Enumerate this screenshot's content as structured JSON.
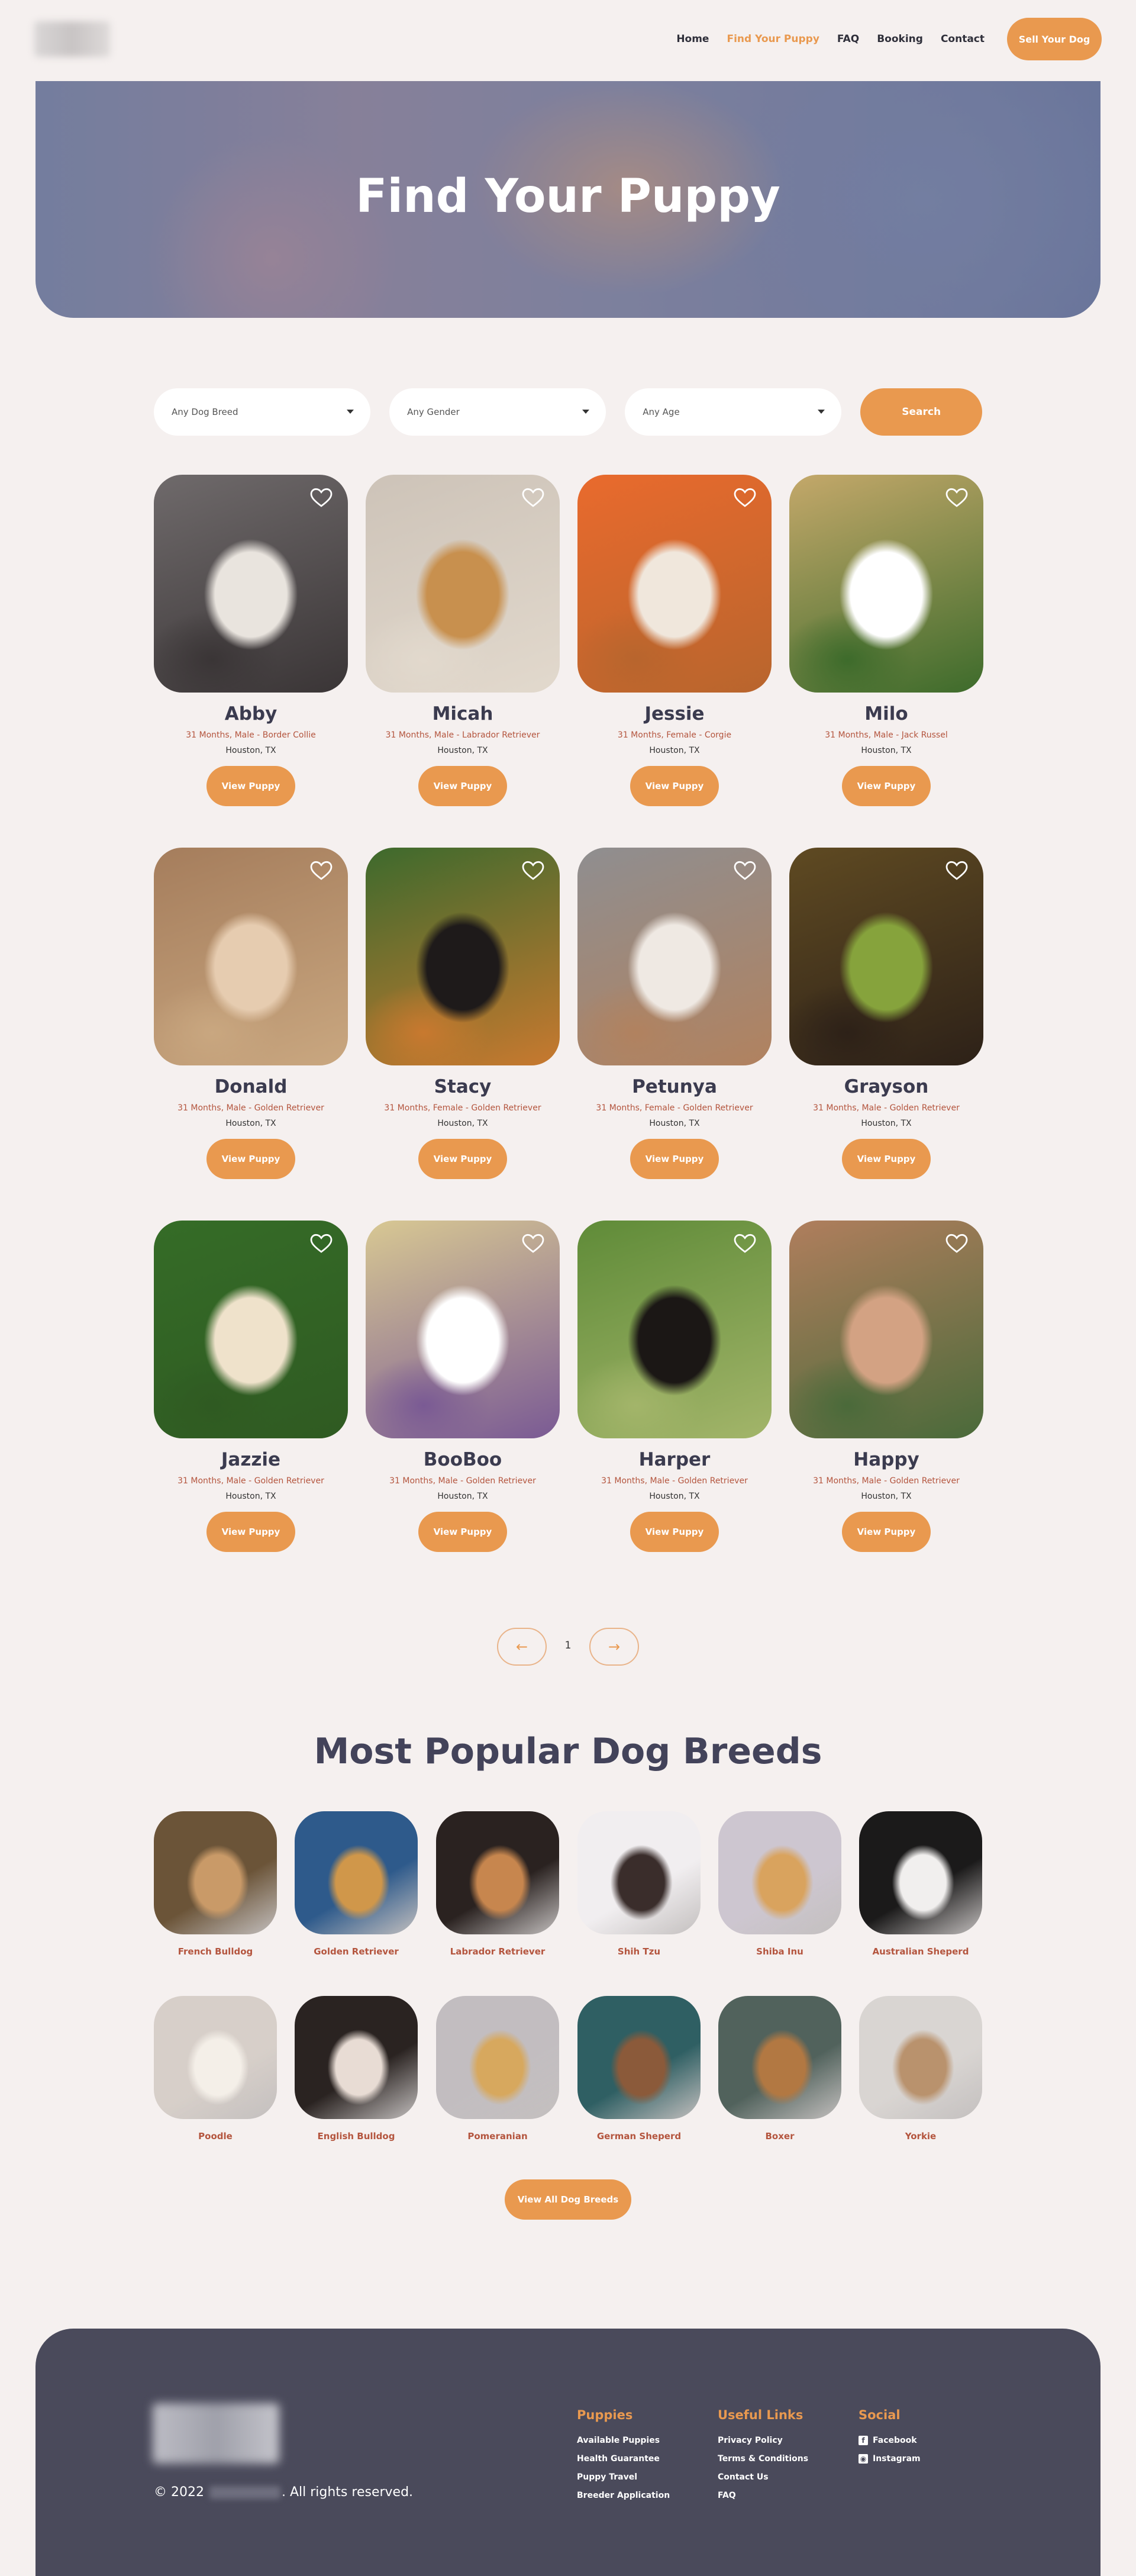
{
  "header": {
    "nav": [
      "Home",
      "Find Your Puppy",
      "FAQ",
      "Booking",
      "Contact"
    ],
    "active_index": 1,
    "sell_button": "Sell Your Dog"
  },
  "hero": {
    "title": "Find Your Puppy"
  },
  "filters": {
    "breed": "Any Dog Breed",
    "gender": "Any Gender",
    "age": "Any Age",
    "search_button": "Search"
  },
  "puppies": [
    {
      "name": "Abby",
      "meta": "31 Months, Male - Border Collie",
      "location": "Houston, TX",
      "button": "View Puppy",
      "colors": [
        "#6f6a6b",
        "#e9e4de",
        "#3a3536"
      ]
    },
    {
      "name": "Micah",
      "meta": "31 Months, Male - Labrador Retriever",
      "location": "Houston, TX",
      "button": "View Puppy",
      "colors": [
        "#cdc3b8",
        "#c8904e",
        "#e2d9cd"
      ]
    },
    {
      "name": "Jessie",
      "meta": "31 Months, Female - Corgie",
      "location": "Houston, TX",
      "button": "View Puppy",
      "colors": [
        "#e96a2d",
        "#f0e7dc",
        "#b8652d"
      ]
    },
    {
      "name": "Milo",
      "meta": "31 Months, Male - Jack Russel",
      "location": "Houston, TX",
      "button": "View Puppy",
      "colors": [
        "#c4a86a",
        "#ffffff",
        "#3d6b2b"
      ]
    },
    {
      "name": "Donald",
      "meta": "31 Months, Male - Golden Retriever",
      "location": "Houston, TX",
      "button": "View Puppy",
      "colors": [
        "#a57d5c",
        "#e6ccb0",
        "#c9a780"
      ]
    },
    {
      "name": "Stacy",
      "meta": "31 Months, Female - Golden Retriever",
      "location": "Houston, TX",
      "button": "View Puppy",
      "colors": [
        "#3d6a2d",
        "#1e1a1a",
        "#c8792f"
      ]
    },
    {
      "name": "Petunya",
      "meta": "31 Months, Female - Golden Retriever",
      "location": "Houston, TX",
      "button": "View Puppy",
      "colors": [
        "#8f8e90",
        "#efe9e3",
        "#b1825f"
      ]
    },
    {
      "name": "Grayson",
      "meta": "31 Months, Male - Golden Retriever",
      "location": "Houston, TX",
      "button": "View Puppy",
      "colors": [
        "#5f4a22",
        "#86a33c",
        "#2d2118"
      ]
    },
    {
      "name": "Jazzie",
      "meta": "31 Months, Male - Golden Retriever",
      "location": "Houston, TX",
      "button": "View Puppy",
      "colors": [
        "#356c27",
        "#efe2cb",
        "#2f5a22"
      ]
    },
    {
      "name": "BooBoo",
      "meta": "31 Months, Male - Golden Retriever",
      "location": "Houston, TX",
      "button": "View Puppy",
      "colors": [
        "#d8c893",
        "#ffffff",
        "#7a5a94"
      ]
    },
    {
      "name": "Harper",
      "meta": "31 Months, Male - Golden Retriever",
      "location": "Houston, TX",
      "button": "View Puppy",
      "colors": [
        "#5f8b38",
        "#1b1715",
        "#a3b56a"
      ]
    },
    {
      "name": "Happy",
      "meta": "31 Months, Male - Golden Retriever",
      "location": "Houston, TX",
      "button": "View Puppy",
      "colors": [
        "#b07e5d",
        "#d3a283",
        "#4a6a3a"
      ]
    }
  ],
  "pagination": {
    "page": "1",
    "prev_icon": "arrow-left-icon",
    "next_icon": "arrow-right-icon"
  },
  "breeds_section": {
    "title": "Most Popular Dog Breeds",
    "breeds": [
      {
        "name": "French Bulldog",
        "colors": [
          "#6b5438",
          "#c99a68"
        ]
      },
      {
        "name": "Golden Retriever",
        "colors": [
          "#2e5a8b",
          "#d0974a"
        ]
      },
      {
        "name": "Labrador Retriever",
        "colors": [
          "#2a2220",
          "#c7864e"
        ]
      },
      {
        "name": "Shih Tzu",
        "colors": [
          "#f1eef0",
          "#3a2d2b"
        ]
      },
      {
        "name": "Shiba Inu",
        "colors": [
          "#cdc6d0",
          "#d9a35e"
        ]
      },
      {
        "name": "Australian Sheperd",
        "colors": [
          "#1b1a1a",
          "#f1efee"
        ]
      },
      {
        "name": "Poodle",
        "colors": [
          "#d7cfc9",
          "#f4efe8"
        ]
      },
      {
        "name": "English Bulldog",
        "colors": [
          "#2a2321",
          "#e8dcd4"
        ]
      },
      {
        "name": "Pomeranian",
        "colors": [
          "#c2bdc0",
          "#d7a85e"
        ]
      },
      {
        "name": "German Sheperd",
        "colors": [
          "#2f5f63",
          "#8b5a3a"
        ]
      },
      {
        "name": "Boxer",
        "colors": [
          "#51625c",
          "#b27842"
        ]
      },
      {
        "name": "Yorkie",
        "colors": [
          "#d9d5d2",
          "#b9926d"
        ]
      }
    ],
    "button": "View All Dog Breeds"
  },
  "footer": {
    "copyright_prefix": "© 2022",
    "copyright_suffix": ". All rights reserved.",
    "columns": [
      {
        "title": "Puppies",
        "links": [
          "Available Puppies",
          "Health Guarantee",
          "Puppy Travel",
          "Breeder Application"
        ]
      },
      {
        "title": "Useful Links",
        "links": [
          "Privacy Policy",
          "Terms & Conditions",
          "Contact Us",
          "FAQ"
        ]
      },
      {
        "title": "Social",
        "links": [
          "Facebook",
          "Instagram"
        ],
        "icons": [
          "facebook-icon",
          "instagram-icon"
        ]
      }
    ]
  },
  "colors": {
    "accent": "#e9994f",
    "text": "#43435a",
    "background": "#f5f0ef",
    "footer": "#4a4a5b"
  }
}
